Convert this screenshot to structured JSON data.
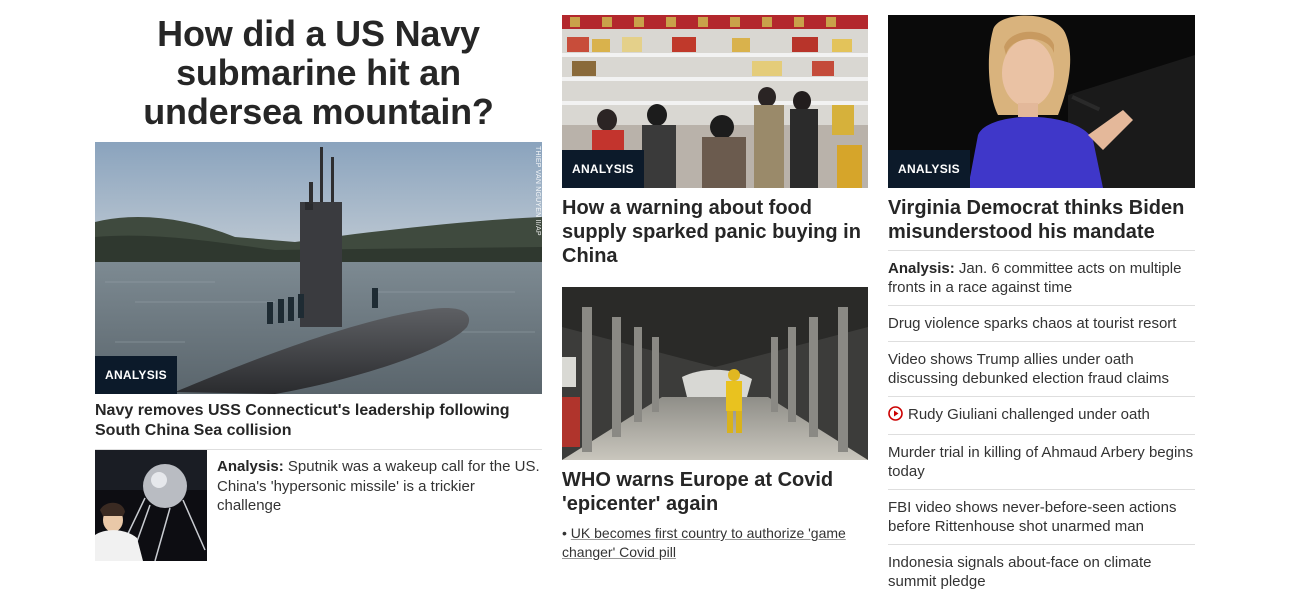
{
  "col1": {
    "headline": "How did a US Navy submarine hit an undersea mountain?",
    "hero": {
      "badge": "ANALYSIS",
      "credit": "THIEP VAN NGUYEN II/AP",
      "headline": "Navy removes USS Connecticut's leadership following South China Sea collision"
    },
    "analysis": {
      "label": "Analysis:",
      "text": "Sputnik was a wakeup call for the US. China's 'hypersonic missile' is a trickier challenge"
    }
  },
  "col2": {
    "card1": {
      "badge": "ANALYSIS",
      "headline": "How a warning about food supply sparked panic buying in China"
    },
    "card2": {
      "headline": "WHO warns Europe at Covid 'epicenter' again",
      "bullet": "UK becomes first country to authorize 'game changer' Covid pill",
      "bullet_marker": "•"
    }
  },
  "col3": {
    "card": {
      "badge": "ANALYSIS",
      "headline": "Virginia Democrat thinks Biden misunderstood his mandate"
    },
    "list": [
      {
        "label": "Analysis:",
        "text": "Jan. 6 committee acts on multiple fronts in a race against time"
      },
      {
        "text": "Drug violence sparks chaos at tourist resort"
      },
      {
        "text": "Video shows Trump allies under oath discussing debunked election fraud claims"
      },
      {
        "text": "Rudy Giuliani challenged under oath",
        "icon": "play-circle-icon"
      },
      {
        "text": "Murder trial in killing of Ahmaud Arbery begins today"
      },
      {
        "text": "FBI video shows never-before-seen actions before Rittenhouse shot unarmed man"
      },
      {
        "text": "Indonesia signals about-face on climate summit pledge"
      }
    ]
  },
  "colors": {
    "badge_bg": "#0c1a2a",
    "play_icon": "#cc0000",
    "divider": "#dedede"
  }
}
